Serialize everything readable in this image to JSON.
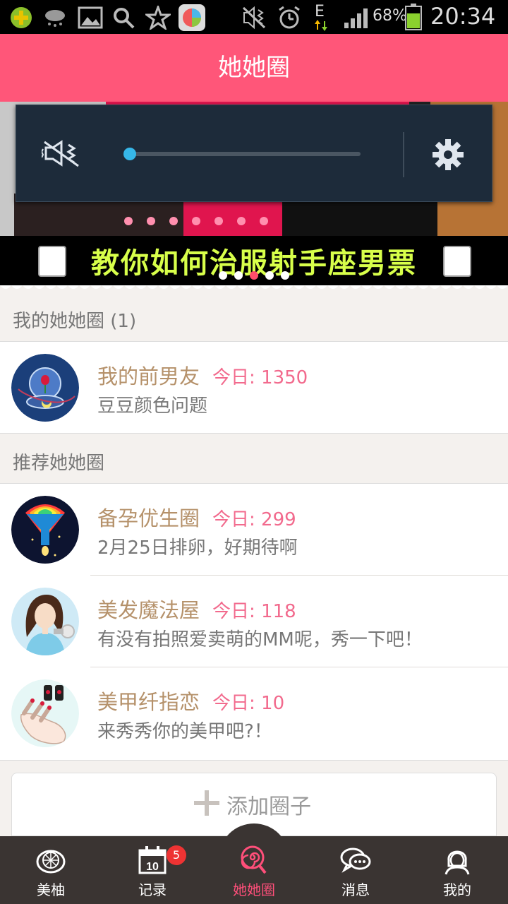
{
  "status_bar": {
    "battery": "68%",
    "time": "20:34",
    "network": "E"
  },
  "header": {
    "title": "她她圈"
  },
  "banner": {
    "caption": "教你如何治服射手座男票",
    "page_count": 5,
    "active_page": 3
  },
  "volume_panel": {
    "level": 0.0
  },
  "my_section": {
    "title": "我的她她圈 (1)",
    "items": [
      {
        "name": "我的前男友",
        "today": "今日: 1350",
        "desc": "豆豆颜色问题",
        "avatar": "rose-globe-icon"
      }
    ]
  },
  "recommended_section": {
    "title": "推荐她她圈",
    "items": [
      {
        "name": "备孕优生圈",
        "today": "今日: 299",
        "desc": "2月25日排卵，好期待啊",
        "avatar": "rainbow-funnel-icon"
      },
      {
        "name": "美发魔法屋",
        "today": "今日: 118",
        "desc": "有没有拍照爱卖萌的MM呢，秀一下吧！",
        "avatar": "hair-girl-icon"
      },
      {
        "name": "美甲纤指恋",
        "today": "今日: 10",
        "desc": "来秀秀你的美甲吧?！",
        "avatar": "manicure-hand-icon"
      }
    ]
  },
  "add_button": {
    "label": "添加圈子"
  },
  "tabs": [
    {
      "label": "美柚",
      "icon": "grapefruit-icon"
    },
    {
      "label": "记录",
      "icon": "calendar-icon",
      "badge": "5",
      "calendar_day": "10"
    },
    {
      "label": "她她圈",
      "icon": "lollipop-icon",
      "active": true
    },
    {
      "label": "消息",
      "icon": "chat-bubbles-icon"
    },
    {
      "label": "我的",
      "icon": "profile-icon"
    }
  ],
  "colors": {
    "brand_pink": "#ff5679",
    "name_tan": "#b5916a",
    "today_pink": "#f26a8d",
    "tabbar_bg": "#3a3432",
    "volume_knob": "#36b7e8"
  }
}
